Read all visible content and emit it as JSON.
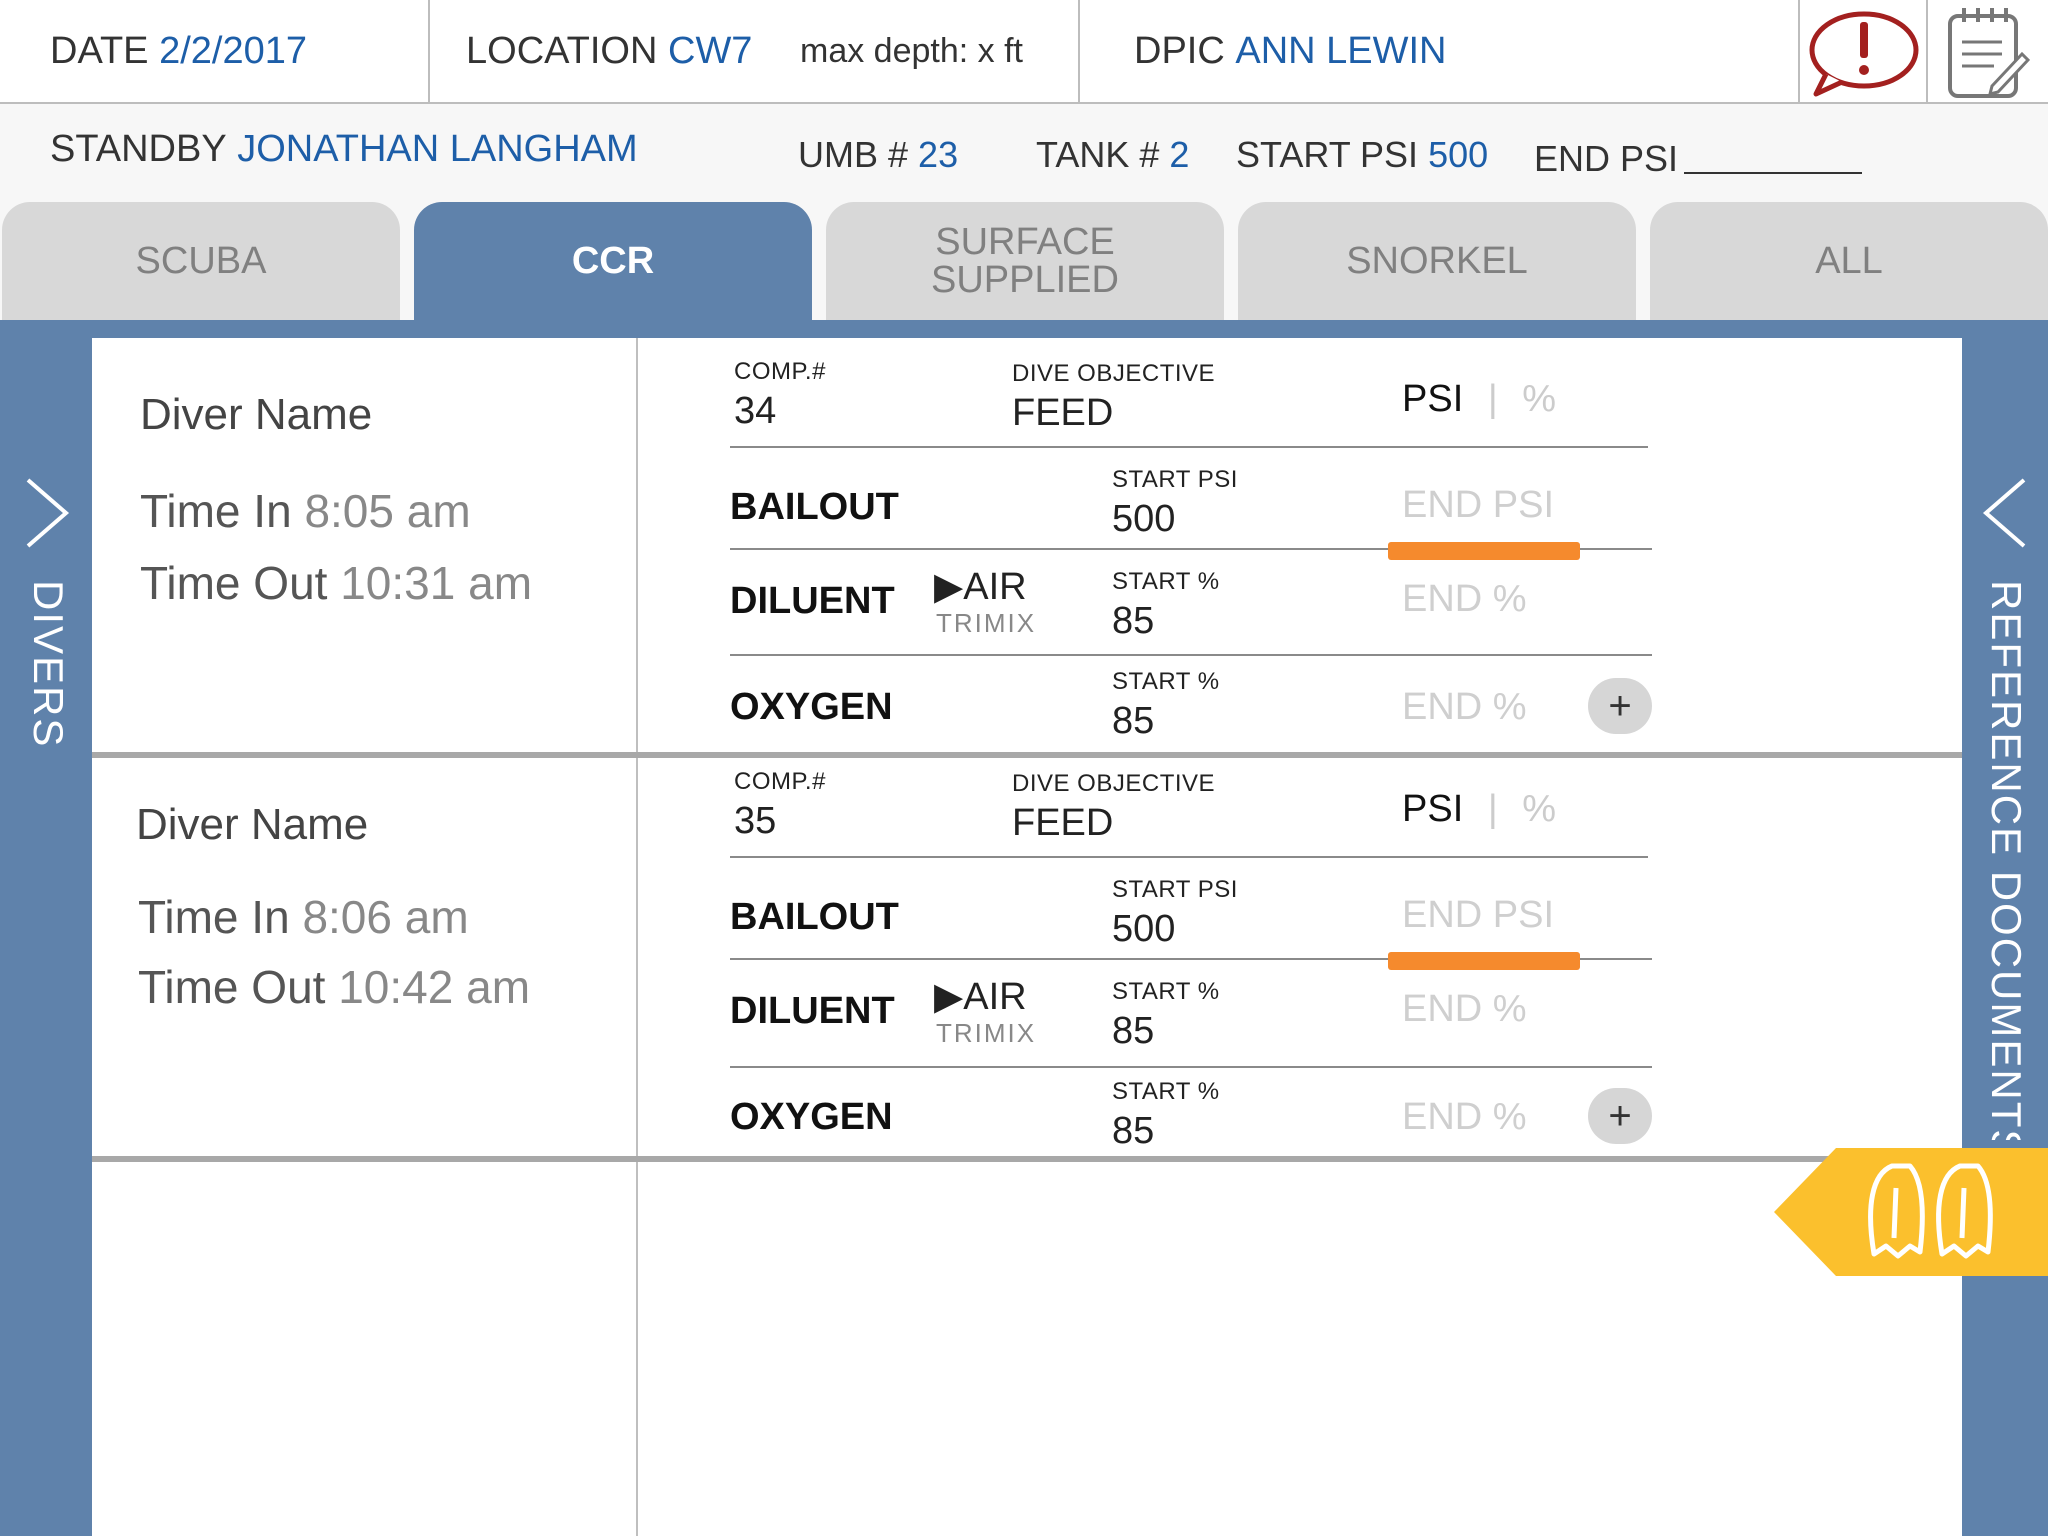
{
  "header": {
    "date_label": "DATE",
    "date_value": "2/2/2017",
    "location_label": "LOCATION",
    "location_value": "CW7",
    "max_depth": "max depth: x ft",
    "dpic_label": "DPIC",
    "dpic_value": "ANN LEWIN"
  },
  "standby": {
    "standby_label": "STANDBY",
    "standby_value": "JONATHAN LANGHAM",
    "umb_label": "UMB #",
    "umb_value": "23",
    "tank_label": "TANK #",
    "tank_value": "2",
    "start_psi_label": "START PSI",
    "start_psi_value": "500",
    "end_psi_label": "END PSI"
  },
  "tabs": [
    {
      "label": "SCUBA"
    },
    {
      "label": "CCR"
    },
    {
      "label_line1": "SURFACE",
      "label_line2": "SUPPLIED"
    },
    {
      "label": "SNORKEL"
    },
    {
      "label": "ALL"
    }
  ],
  "active_tab": "CCR",
  "left_rail": {
    "label": "DIVERS"
  },
  "right_rail": {
    "label": "REFERENCE DOCUMENTS"
  },
  "divers": [
    {
      "name": "Diver Name",
      "time_in_label": "Time In",
      "time_in": "8:05 am",
      "time_out_label": "Time Out",
      "time_out": "10:31 am",
      "comp_label": "COMP.#",
      "comp_value": "34",
      "objective_label": "DIVE OBJECTIVE",
      "objective_value": "FEED",
      "unit_psi": "PSI",
      "unit_sep": "|",
      "unit_pct": "%",
      "bailout_label": "BAILOUT",
      "bailout_start_label": "START PSI",
      "bailout_start_value": "500",
      "bailout_end_placeholder": "END PSI",
      "diluent_label": "DILUENT",
      "diluent_gas_selected": "▶AIR",
      "diluent_gas_other": "TRIMIX",
      "diluent_start_label": "START %",
      "diluent_start_value": "85",
      "diluent_end_placeholder": "END %",
      "oxygen_label": "OXYGEN",
      "oxygen_start_label": "START %",
      "oxygen_start_value": "85",
      "oxygen_end_placeholder": "END %",
      "add_label": "+"
    },
    {
      "name": "Diver Name",
      "time_in_label": "Time In",
      "time_in": "8:06 am",
      "time_out_label": "Time Out",
      "time_out": "10:42 am",
      "comp_label": "COMP.#",
      "comp_value": "35",
      "objective_label": "DIVE OBJECTIVE",
      "objective_value": "FEED",
      "unit_psi": "PSI",
      "unit_sep": "|",
      "unit_pct": "%",
      "bailout_label": "BAILOUT",
      "bailout_start_label": "START PSI",
      "bailout_start_value": "500",
      "bailout_end_placeholder": "END PSI",
      "diluent_label": "DILUENT",
      "diluent_gas_selected": "▶AIR",
      "diluent_gas_other": "TRIMIX",
      "diluent_start_label": "START %",
      "diluent_start_value": "85",
      "diluent_end_placeholder": "END %",
      "oxygen_label": "OXYGEN",
      "oxygen_start_label": "START %",
      "oxygen_start_value": "85",
      "oxygen_end_placeholder": "END %",
      "add_label": "+"
    }
  ],
  "icons": {
    "alert": "alert-speech-bubble-icon",
    "notes": "notepad-icon",
    "fins": "fins-icon"
  },
  "colors": {
    "accent_blue": "#5f82ab",
    "value_blue": "#1d5ea8",
    "alert_red": "#a3201f",
    "progress_orange": "#f58a2d",
    "fins_yellow": "#fbc02d"
  }
}
